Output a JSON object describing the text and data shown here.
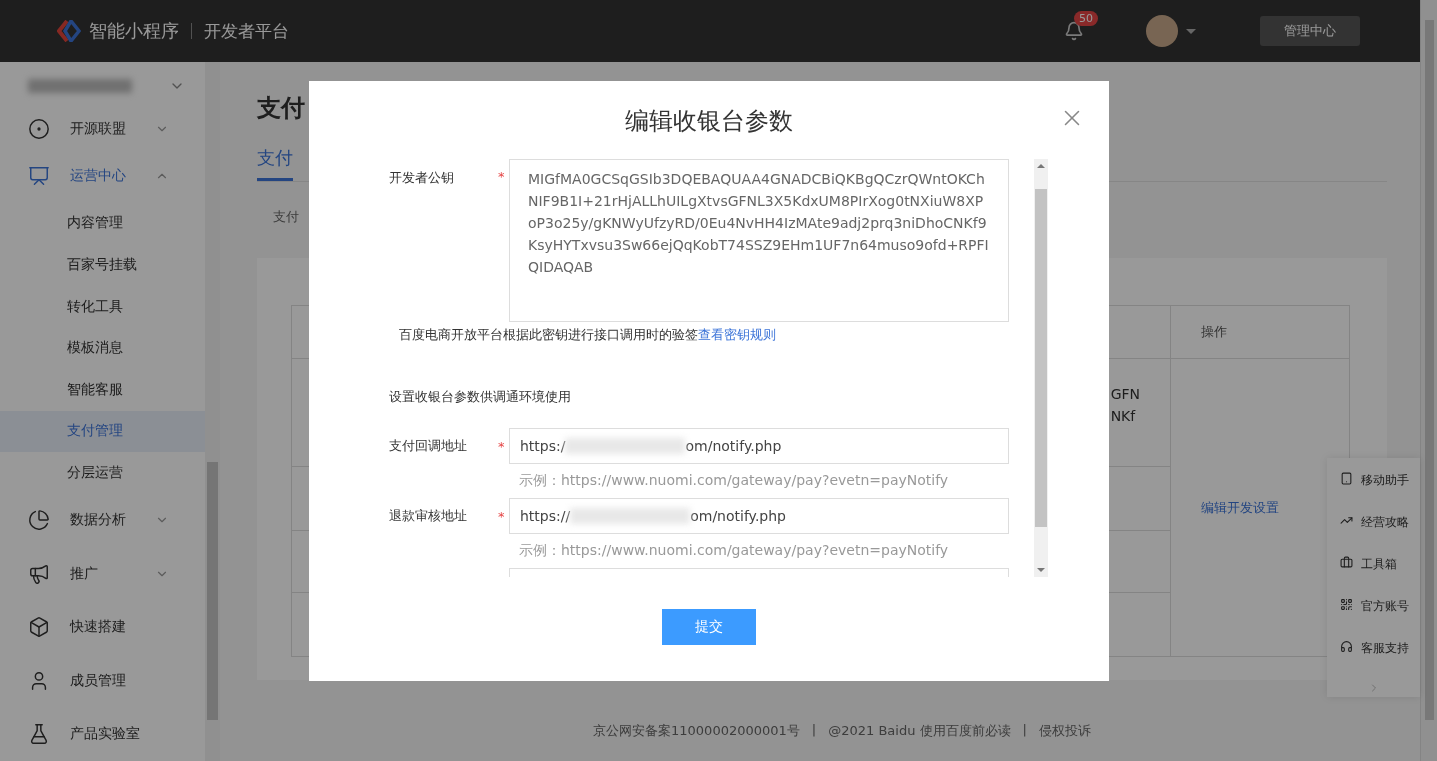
{
  "header": {
    "brand": "智能小程序",
    "platform": "开发者平台",
    "notification_count": "50",
    "admin_button": "管理中心"
  },
  "sidebar": {
    "items": [
      {
        "label": "开源联盟",
        "kind": "menu",
        "expanded": false,
        "selected": false
      },
      {
        "label": "运营中心",
        "kind": "menu",
        "expanded": true,
        "selected": true,
        "children": [
          {
            "label": "内容管理",
            "selected": false
          },
          {
            "label": "百家号挂载",
            "selected": false
          },
          {
            "label": "转化工具",
            "selected": false
          },
          {
            "label": "模板消息",
            "selected": false
          },
          {
            "label": "智能客服",
            "selected": false
          },
          {
            "label": "支付管理",
            "selected": true
          },
          {
            "label": "分层运营",
            "selected": false
          }
        ]
      },
      {
        "label": "数据分析",
        "kind": "menu",
        "expanded": false,
        "selected": false
      },
      {
        "label": "推广",
        "kind": "menu",
        "expanded": false,
        "selected": false
      },
      {
        "label": "快速搭建",
        "kind": "link",
        "selected": false
      },
      {
        "label": "成员管理",
        "kind": "link",
        "selected": false
      },
      {
        "label": "产品实验室",
        "kind": "link",
        "selected": false
      }
    ]
  },
  "page": {
    "title": "支付",
    "tabs": [
      {
        "label": "支付",
        "selected": true
      }
    ],
    "subtab": "支付",
    "table": {
      "columns": [
        "操作"
      ],
      "first_cell_lines": [
        "GFN",
        "NKf"
      ],
      "action_link": "编辑开发设置"
    }
  },
  "floating_tools": [
    {
      "label": "移动助手"
    },
    {
      "label": "经营攻略"
    },
    {
      "label": "工具箱"
    },
    {
      "label": "官方账号"
    },
    {
      "label": "客服支持"
    }
  ],
  "footer": {
    "separator": "|",
    "items": [
      "京公网安备案11000002000001号",
      "@2021 Baidu 使用百度前必读",
      "侵权投诉"
    ]
  },
  "dialog": {
    "title": "编辑收银台参数",
    "public_key": {
      "label": "开发者公钥",
      "required_mark": "*",
      "value": "MIGfMA0GCSqGSIb3DQEBAQUAA4GNADCBiQKBgQCzrQWntOKChNIF9B1I+21rHjALLhUILgXtvsGFNL3X5KdxUM8PIrXog0tNXiuW8XPoP3o25y/gKNWyUfzyRD/0Eu4NvHH4IzMAte9adj2prq3niDhoCNKf9KsyHYTxvsu3Sw66ejQqKobT74SSZ9EHm1UF7n64muso9ofd+RPFIQIDAQAB",
      "note": "百度电商开放平台根据此密钥进行接口调用时的验签",
      "note_link": "查看密钥规则"
    },
    "section_note": "设置收银台参数供调通环境使用",
    "url_fields": [
      {
        "label": "支付回调地址",
        "required_mark": "*",
        "value_start": "https:/",
        "value_end": "om/notify.php",
        "example": "示例：https://www.nuomi.com/gateway/pay?evetn=payNotify"
      },
      {
        "label": "退款审核地址",
        "required_mark": "*",
        "value_start": "https://",
        "value_end": "om/notify.php",
        "example": "示例：https://www.nuomi.com/gateway/pay?evetn=payNotify"
      }
    ],
    "submit": "提交"
  }
}
